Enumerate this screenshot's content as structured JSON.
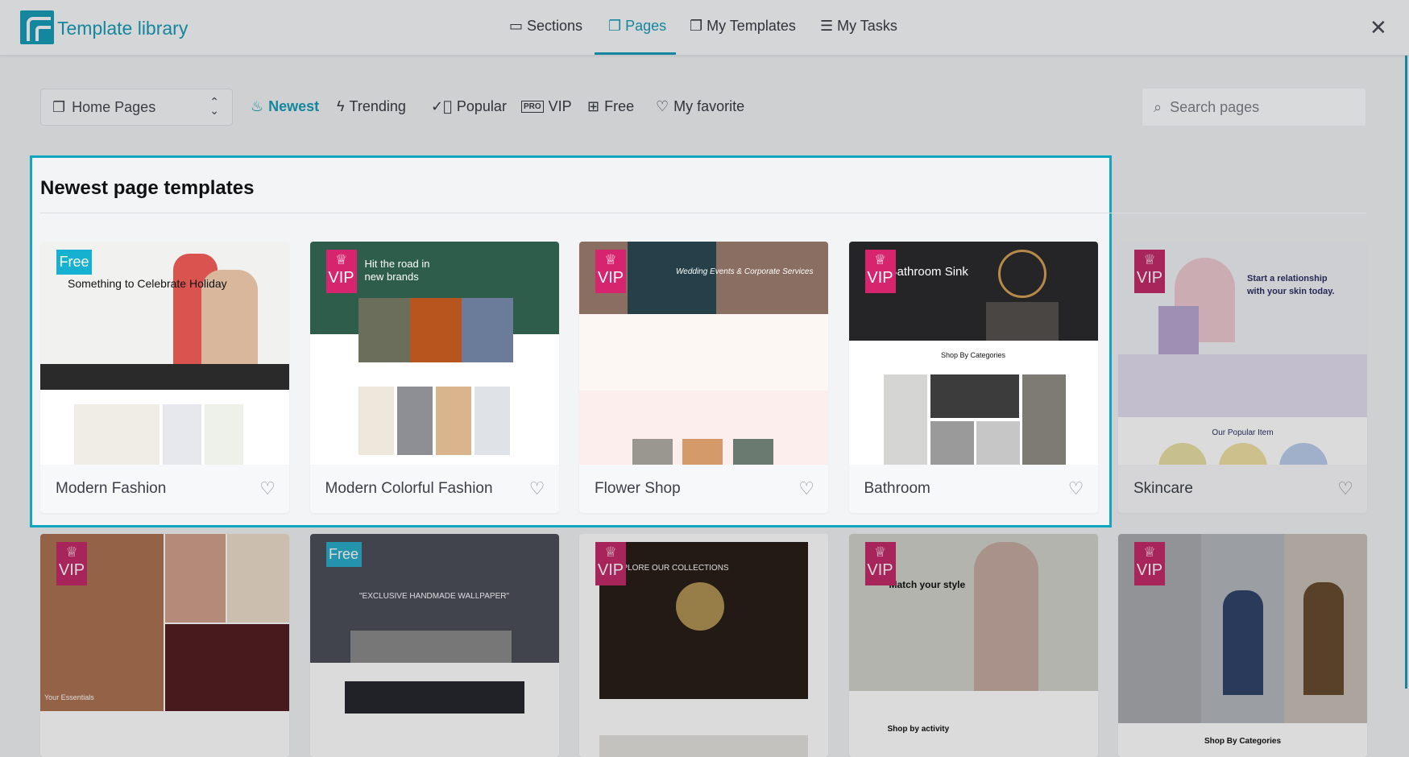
{
  "header": {
    "title": "Template library",
    "tabs": [
      {
        "label": "Sections",
        "icon": "sections-icon"
      },
      {
        "label": "Pages",
        "icon": "pages-icon",
        "active": true
      },
      {
        "label": "My Templates",
        "icon": "templates-icon"
      },
      {
        "label": "My Tasks",
        "icon": "tasks-icon"
      }
    ],
    "close": "✕"
  },
  "toolbar": {
    "category": "Home Pages",
    "filters": [
      {
        "label": "Newest",
        "icon": "flame-icon",
        "active": true
      },
      {
        "label": "Trending",
        "icon": "bolt-icon"
      },
      {
        "label": "Popular",
        "icon": "check-circle-icon"
      },
      {
        "label": "VIP",
        "icon": "pro-icon"
      },
      {
        "label": "Free",
        "icon": "gift-icon"
      },
      {
        "label": "My favorite",
        "icon": "heart-icon"
      }
    ],
    "search_placeholder": "Search pages"
  },
  "section": {
    "title": "Newest page templates"
  },
  "colors": {
    "accent": "#14869e",
    "highlight": "#12a5c0",
    "vip": "#d6246e",
    "free": "#16b1d1"
  },
  "templates": [
    {
      "name": "Modern Fashion",
      "badge": "Free",
      "hero": "Something to Celebrate Holiday"
    },
    {
      "name": "Modern Colorful Fashion",
      "badge": "VIP",
      "hero": "Hit the road in new brands"
    },
    {
      "name": "Flower Shop",
      "badge": "VIP",
      "hero": "Wedding Events & Corporate Services"
    },
    {
      "name": "Bathroom",
      "badge": "VIP",
      "hero": "Bathroom Sink",
      "sub": "Shop By Categories"
    },
    {
      "name": "Skincare",
      "badge": "VIP",
      "hero": "Start a relationship with your skin today.",
      "sub": "Our Popular Item"
    },
    {
      "name": "",
      "badge": "VIP",
      "hero": "Your Essentials"
    },
    {
      "name": "",
      "badge": "Free",
      "hero": "\"EXCLUSIVE HANDMADE WALLPAPER\""
    },
    {
      "name": "",
      "badge": "VIP",
      "hero": "EXPLORE OUR COLLECTIONS"
    },
    {
      "name": "",
      "badge": "VIP",
      "hero": "Match your style",
      "sub": "Shop by activity"
    },
    {
      "name": "",
      "badge": "VIP",
      "hero": "",
      "sub": "Shop By Categories"
    }
  ]
}
